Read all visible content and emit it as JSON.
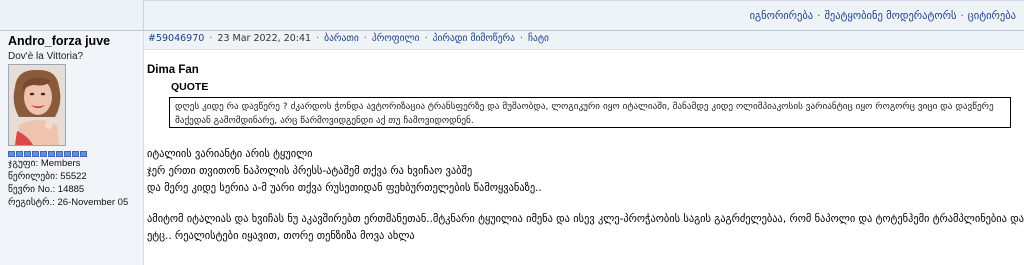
{
  "top_links": {
    "ignore": "იგნორირება",
    "notify_moderator": "შეატყობინე მოდერატორს",
    "quote": "ციტირება"
  },
  "user": {
    "name": "Andro_forza juve",
    "title": "Dov'è la Vittoria?",
    "reputation_pips": 10,
    "stats": [
      {
        "label": "ჯგუფი:",
        "value": "Members"
      },
      {
        "label": "წერილები:",
        "value": "55522"
      },
      {
        "label": "წევრი No.:",
        "value": "14885"
      },
      {
        "label": "რეგისტრ.:",
        "value": "26-November 05"
      }
    ]
  },
  "post": {
    "number": "#59046970",
    "date": "23 Mar 2022, 20:41",
    "actions": [
      "ბარათი",
      "პროფილი",
      "პირადი მიმოწერა",
      "ჩატი"
    ],
    "quoted_user": "Dima Fan",
    "quote_label": "QUOTE",
    "quote_text": "დღეს კიდე რა დავწერე ? ძკარდოს ჭონდა ავტორიზაცია ტრანსფერზე და მუშაობდა, ლოგიკური იყო იტალიაში, მანამდე კიდე ოლიმპიაკოსის ვარიანტიც იყო როგორც ვიცი და დავწერე მაქედან გამომდინარე, არც წარმოვიდგენდი აქ თუ ჩამოვიდოდნენ.",
    "lines": [
      "იტალიის ვარიანტი არის ტყუილი",
      "ჯერ ერთი თვითონ ნაპოლის პრესს-ატაშემ თქვა რა ხვიჩაო ვაბშე",
      "და მერე კიდე სერია ა-მ უარი თქვა რუსეთიდან ფეხბურთელების წამოყვანაზე..",
      "ამიტომ იტალიას და ხვიჩას ნუ აკავშირებთ ერთმანეთან..მტკნარი ტყუილია იმენა და ისევ კლე-პროჭაობის საგის გაგრძელებაა, რომ ნაპოლი და ტოტენჰემი ტრამპლინებია და",
      "ეტც.. რეალისტები იყავით, თორე თენზიზა მოვა ახლა"
    ]
  },
  "colors": {
    "link": "#1f3f8a",
    "header_bg": "#eef3f8",
    "sidebar_bg": "#f1f4f8",
    "rep_pip": "#5f8fd6"
  }
}
